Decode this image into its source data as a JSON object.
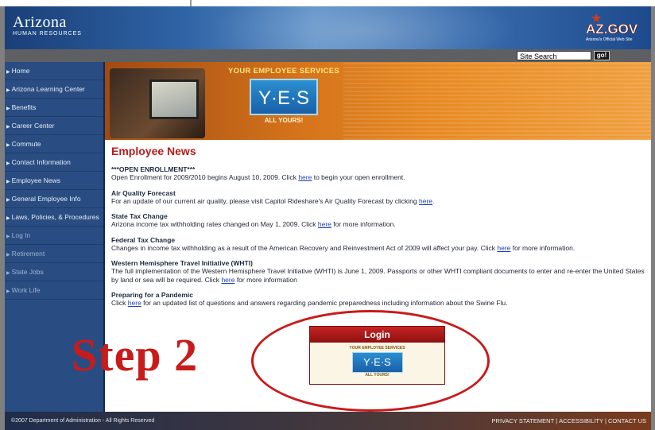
{
  "header": {
    "brand_name": "Arizona",
    "brand_sub": "HUMAN RESOURCES",
    "azgov_logo": "AZ.GOV",
    "azgov_tag": "Arizona's Official Web Site"
  },
  "search": {
    "value": "Site Search",
    "go_label": "go!"
  },
  "sidebar": {
    "items": [
      {
        "label": "Home"
      },
      {
        "label": "Arizona Learning Center"
      },
      {
        "label": "Benefits"
      },
      {
        "label": "Career Center"
      },
      {
        "label": "Commute"
      },
      {
        "label": "Contact Information"
      },
      {
        "label": "Employee News"
      },
      {
        "label": "General Employee Info"
      },
      {
        "label": "Laws, Policies, & Procedures"
      },
      {
        "label": "Log In"
      },
      {
        "label": "Retirement"
      },
      {
        "label": "State Jobs"
      },
      {
        "label": "Work Life"
      }
    ]
  },
  "banner": {
    "top": "YOUR EMPLOYEE SERVICES",
    "logo": "Y·E·S",
    "bottom": "ALL YOURS!"
  },
  "main": {
    "title": "Employee News",
    "news": [
      {
        "heading": "***OPEN ENROLLMENT***",
        "before": "Open Enrollment for 2009/2010 begins August 10, 2009. Click ",
        "link": "here",
        "after": " to begin your open enrollment."
      },
      {
        "heading": "Air Quality Forecast",
        "before": "For an update of our current air quality, please visit Capitol Rideshare's Air Quality Forecast by clicking ",
        "link": "here",
        "after": "."
      },
      {
        "heading": "State Tax Change",
        "before": "Arizona income tax withholding rates changed on May 1, 2009. Click ",
        "link": "here",
        "after": " for more information."
      },
      {
        "heading": "Federal Tax Change",
        "before": "Changes in income tax withholding as a result of the American Recovery and Reinvestment Act of 2009 will affect your pay. Click ",
        "link": "here",
        "after": " for more information."
      },
      {
        "heading": "Western Hemisphere Travel Initiative (WHTI)",
        "before": "The full implementation of the Western Hemisphere Travel Initiative (WHTI) is June 1, 2009. Passports or other WHTI compliant documents to enter and re-enter the United States by land or sea will be required. Click ",
        "link": "here",
        "after": " for more information"
      },
      {
        "heading": "Preparing for a Pandemic",
        "before": "Click ",
        "link": "here",
        "after": " for an updated list of questions and answers regarding pandemic preparedness including information about the Swine Flu."
      }
    ]
  },
  "annotation": {
    "step": "Step 2"
  },
  "login": {
    "title": "Login",
    "top": "YOUR EMPLOYEE SERVICES",
    "logo": "Y·E·S",
    "bottom": "ALL YOURS!"
  },
  "footer": {
    "copyright": "©2007 Department of Administration - All Rights Reserved",
    "privacy": "PRIVACY STATEMENT",
    "accessibility": "ACCESSIBILITY",
    "contact": "CONTACT US",
    "separator": "|"
  },
  "colors": {
    "accent_red": "#b61c1c",
    "nav_blue": "#294d82",
    "link_blue": "#1d3fb5"
  }
}
